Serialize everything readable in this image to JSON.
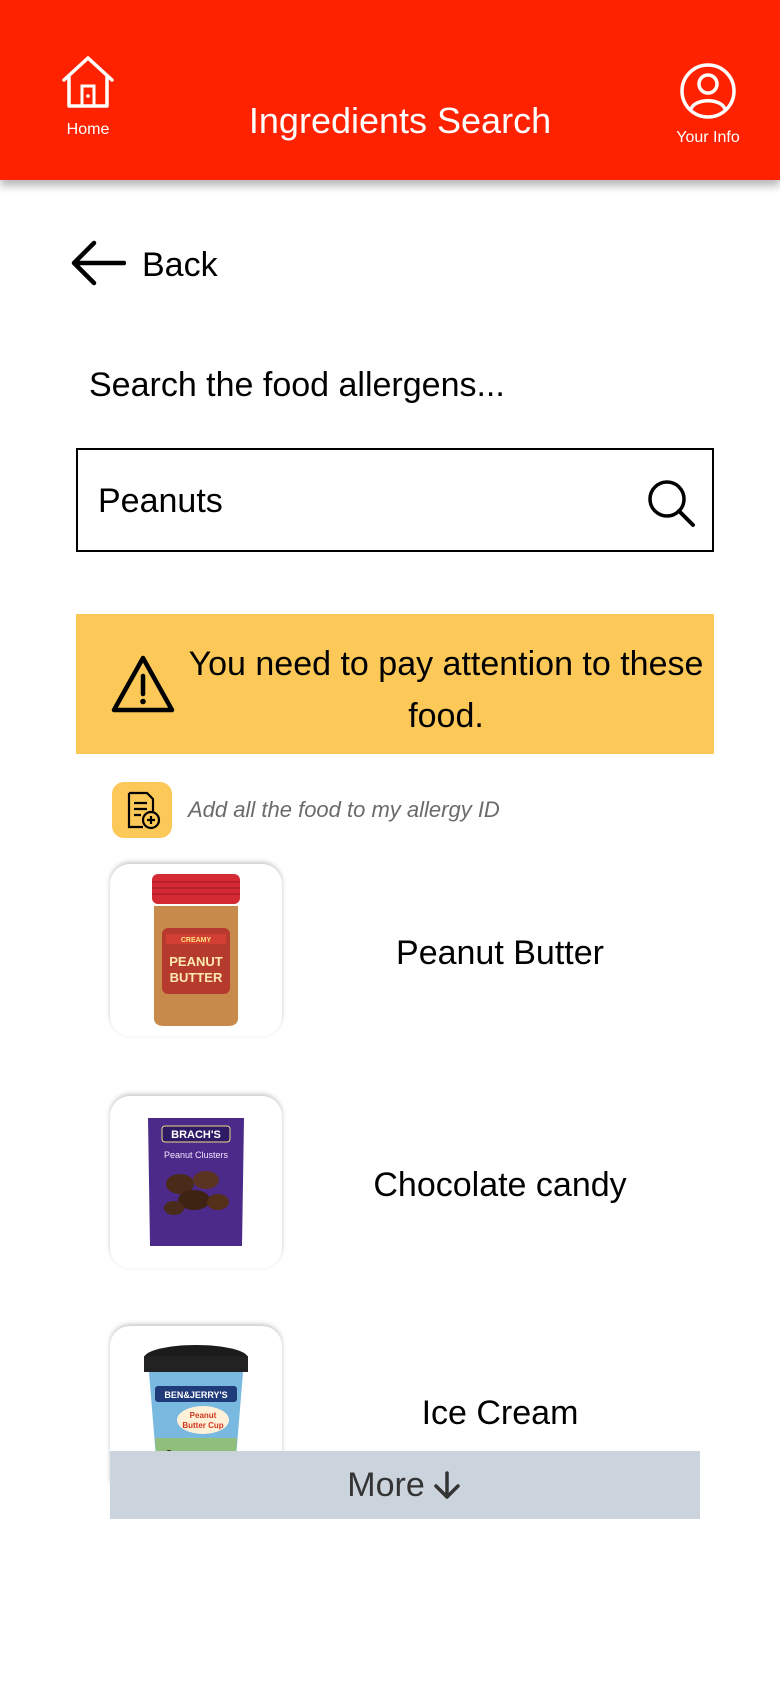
{
  "header": {
    "title": "Ingredients Search",
    "home_label": "Home",
    "info_label": "Your Info",
    "background": "#ff2200"
  },
  "back": {
    "label": "Back"
  },
  "search": {
    "heading": "Search the food allergens...",
    "value": "Peanuts",
    "icon": "search-icon"
  },
  "warning": {
    "text": "You need to pay attention to these food.",
    "icon": "warning-triangle-icon",
    "background": "#fcc858"
  },
  "add_all": {
    "label": "Add all the food to my allergy ID",
    "icon": "add-document-icon"
  },
  "foods": [
    {
      "name": "Peanut Butter",
      "image": "peanut-butter-jar",
      "brand_text": "PEANUT BUTTER",
      "tag": "CREAMY"
    },
    {
      "name": "Chocolate candy",
      "image": "brachs-peanut-clusters-bag",
      "brand_text": "BRACH'S",
      "tag": "Peanut Clusters"
    },
    {
      "name": "Ice Cream",
      "image": "ben-jerrys-peanut-butter-cup-pint",
      "brand_text": "BEN&JERRY'S",
      "tag": "Peanut Butter Cup"
    }
  ],
  "more": {
    "label": "More"
  }
}
